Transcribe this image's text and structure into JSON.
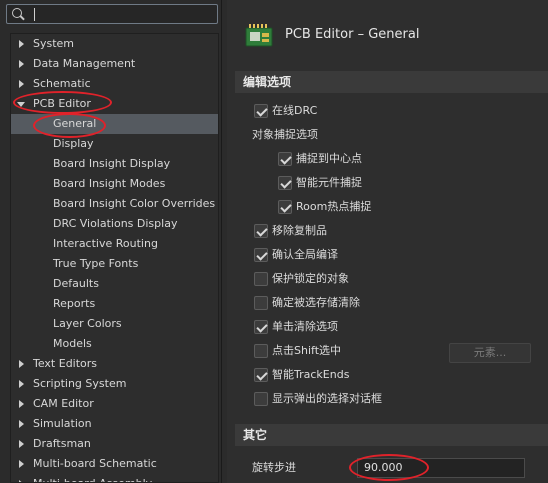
{
  "search": {
    "value": "",
    "placeholder": ""
  },
  "tree": {
    "items": [
      {
        "label": "System",
        "level": 0,
        "expanded": false,
        "selected": false
      },
      {
        "label": "Data Management",
        "level": 0,
        "expanded": false,
        "selected": false
      },
      {
        "label": "Schematic",
        "level": 0,
        "expanded": false,
        "selected": false
      },
      {
        "label": "PCB Editor",
        "level": 0,
        "expanded": true,
        "selected": false
      },
      {
        "label": "General",
        "level": 1,
        "selected": true
      },
      {
        "label": "Display",
        "level": 1,
        "selected": false
      },
      {
        "label": "Board Insight Display",
        "level": 1,
        "selected": false
      },
      {
        "label": "Board Insight Modes",
        "level": 1,
        "selected": false
      },
      {
        "label": "Board Insight Color Overrides",
        "level": 1,
        "selected": false
      },
      {
        "label": "DRC Violations Display",
        "level": 1,
        "selected": false
      },
      {
        "label": "Interactive Routing",
        "level": 1,
        "selected": false
      },
      {
        "label": "True Type Fonts",
        "level": 1,
        "selected": false
      },
      {
        "label": "Defaults",
        "level": 1,
        "selected": false
      },
      {
        "label": "Reports",
        "level": 1,
        "selected": false
      },
      {
        "label": "Layer Colors",
        "level": 1,
        "selected": false
      },
      {
        "label": "Models",
        "level": 1,
        "selected": false
      },
      {
        "label": "Text Editors",
        "level": 0,
        "expanded": false,
        "selected": false
      },
      {
        "label": "Scripting System",
        "level": 0,
        "expanded": false,
        "selected": false
      },
      {
        "label": "CAM Editor",
        "level": 0,
        "expanded": false,
        "selected": false
      },
      {
        "label": "Simulation",
        "level": 0,
        "expanded": false,
        "selected": false
      },
      {
        "label": "Draftsman",
        "level": 0,
        "expanded": false,
        "selected": false
      },
      {
        "label": "Multi-board Schematic",
        "level": 0,
        "expanded": false,
        "selected": false
      },
      {
        "label": "Multi-board Assembly",
        "level": 0,
        "expanded": false,
        "selected": false
      }
    ]
  },
  "header": {
    "title": "PCB Editor – General",
    "icon": "pcb-board-icon"
  },
  "sections": {
    "edit_options": "编辑选项",
    "other": "其它"
  },
  "options": {
    "online_drc": {
      "label": "在线DRC",
      "checked": true
    },
    "snap_group_label": "对象捕捉选项",
    "snap_center": {
      "label": "捕捉到中心点",
      "checked": true
    },
    "smart_component_snap": {
      "label": "智能元件捕捉",
      "checked": true
    },
    "room_hotspot_snap": {
      "label": "Room热点捕捉",
      "checked": true
    },
    "remove_duplicates": {
      "label": "移除复制品",
      "checked": true
    },
    "confirm_global_edit": {
      "label": "确认全局编译",
      "checked": true
    },
    "protect_locked": {
      "label": "保护锁定的对象",
      "checked": false
    },
    "confirm_selection_memory_clear": {
      "label": "确定被选存储清除",
      "checked": false
    },
    "click_clears_selection": {
      "label": "单击清除选项",
      "checked": true
    },
    "shift_click_select": {
      "label": "点击Shift选中",
      "checked": false
    },
    "smart_trackends": {
      "label": "智能TrackEnds",
      "checked": true
    },
    "show_selection_dialog": {
      "label": "显示弹出的选择对话框",
      "checked": false
    },
    "elements_button": "元素..."
  },
  "other": {
    "rotation_step_label": "旋转步进",
    "rotation_step_value": "90.000"
  },
  "annotation_color": "#e0222a"
}
